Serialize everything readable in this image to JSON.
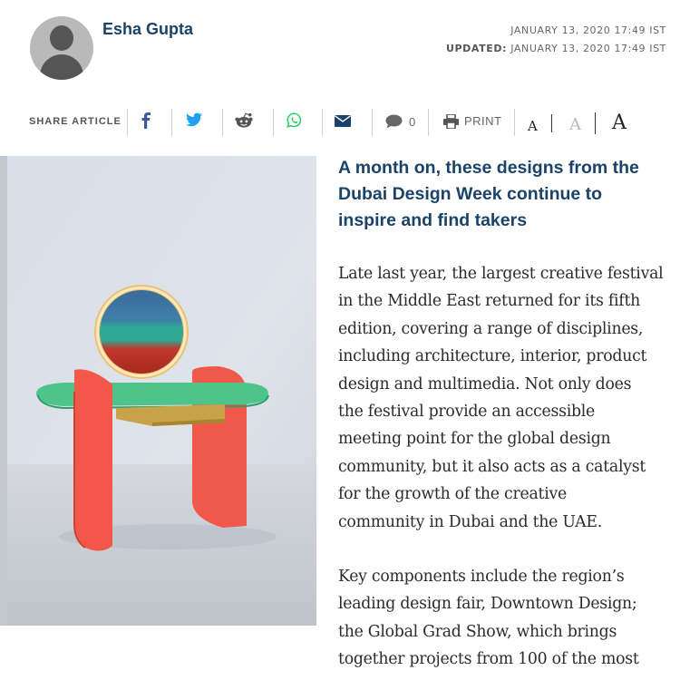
{
  "byline": {
    "author": "Esha Gupta",
    "published": "JANUARY 13, 2020 17:49 IST",
    "updated_label": "UPDATED:",
    "updated": "JANUARY 13, 2020 17:49 IST"
  },
  "share": {
    "label": "SHARE ARTICLE",
    "comment_count": "0",
    "print_label": "PRINT",
    "font_small": "A",
    "font_medium": "A",
    "font_large": "A",
    "icons": [
      "facebook-icon",
      "twitter-icon",
      "reddit-icon",
      "whatsapp-icon",
      "email-icon",
      "comment-icon",
      "print-icon"
    ],
    "colors": {
      "facebook": "#3b5998",
      "twitter": "#1da1f2",
      "whatsapp": "#25d366",
      "email": "#1a4369",
      "muted": "#666666"
    }
  },
  "article": {
    "subhead_lines": [
      "A month on, these designs from the",
      "Dubai Design Week continue to",
      "inspire and find takers"
    ],
    "p1_lines": [
      "Late last year, the largest creative festival",
      "in the Middle East returned for its fifth",
      "edition, covering a range of disciplines,",
      "including architecture, interior, product",
      "design and multimedia. Not only does",
      "the festival provide an accessible",
      "meeting point for the global design",
      "community, but it also acts as a catalyst",
      "for the growth of the creative",
      "community in Dubai and the UAE."
    ],
    "p2_lines": [
      "Key components include the region’s",
      "leading design fair, Downtown Design;",
      "the Global Grad Show, which brings",
      "together projects from 100 of the most"
    ]
  },
  "colors": {
    "heading": "#1a4369",
    "body_text": "#2b2b2b"
  }
}
